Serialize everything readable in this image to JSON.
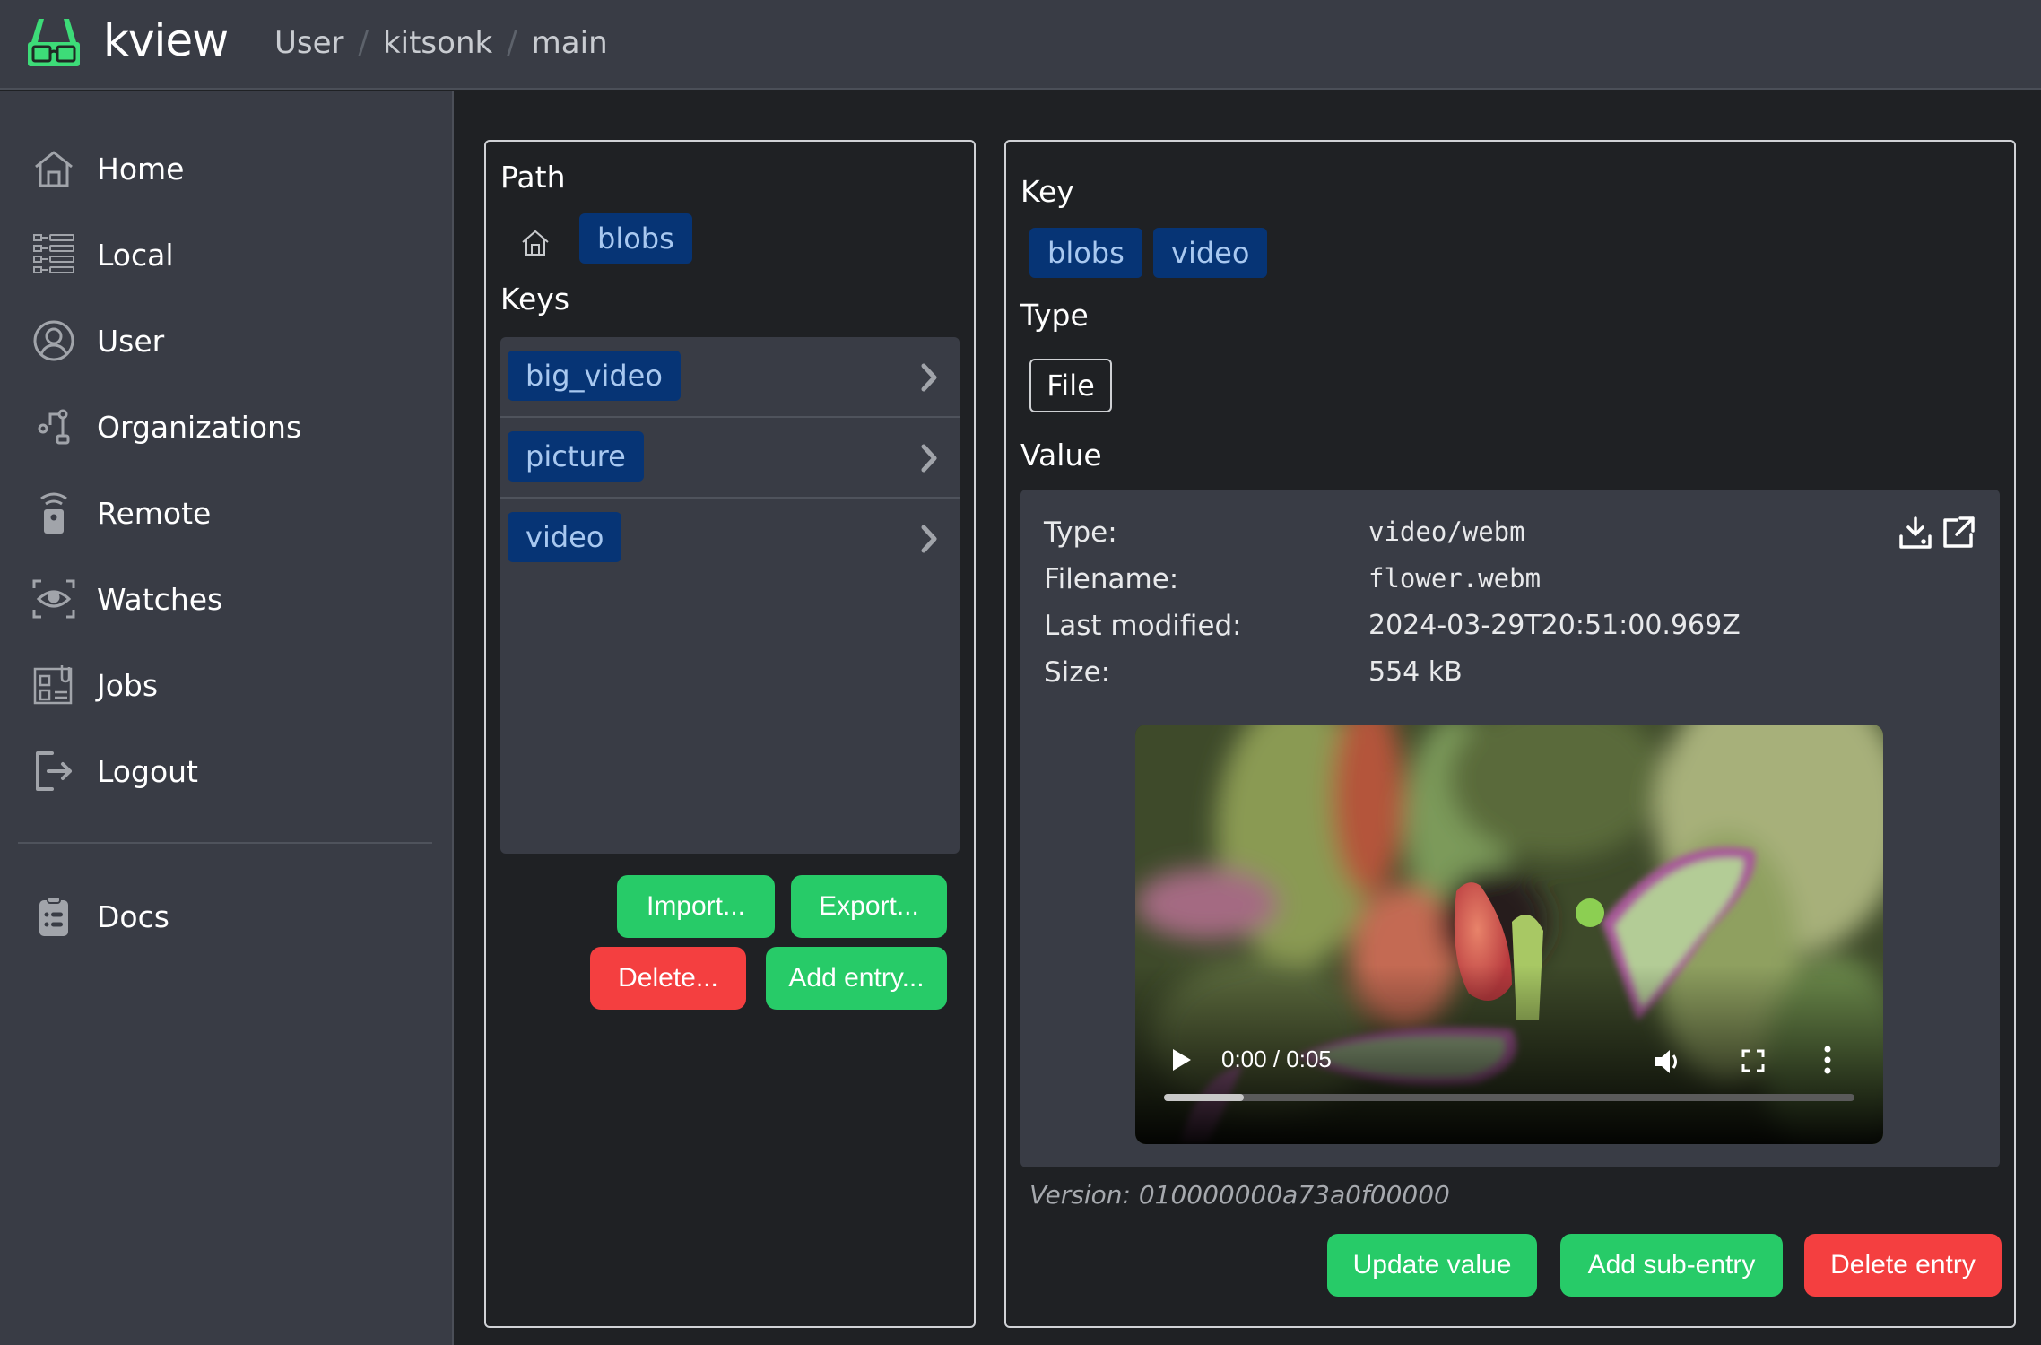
{
  "header": {
    "brand": "kview",
    "breadcrumb": [
      "User",
      "kitsonk",
      "main"
    ],
    "separator": "/",
    "brand_color": "#3ddc78"
  },
  "sidebar": {
    "items": [
      {
        "label": "Home",
        "icon": "home-icon"
      },
      {
        "label": "Local",
        "icon": "local-database-icon"
      },
      {
        "label": "User",
        "icon": "user-icon"
      },
      {
        "label": "Organizations",
        "icon": "organizations-icon"
      },
      {
        "label": "Remote",
        "icon": "remote-icon"
      },
      {
        "label": "Watches",
        "icon": "watches-icon"
      },
      {
        "label": "Jobs",
        "icon": "jobs-icon"
      },
      {
        "label": "Logout",
        "icon": "logout-icon"
      }
    ],
    "footer_items": [
      {
        "label": "Docs",
        "icon": "docs-icon"
      }
    ]
  },
  "left_panel": {
    "path_title": "Path",
    "path": [
      "blobs"
    ],
    "keys_title": "Keys",
    "keys": [
      "big_video",
      "picture",
      "video"
    ],
    "buttons": {
      "import": "Import...",
      "export": "Export...",
      "delete": "Delete...",
      "add_entry": "Add entry..."
    }
  },
  "right_panel": {
    "key_title": "Key",
    "key": [
      "blobs",
      "video"
    ],
    "type_title": "Type",
    "type": "File",
    "value_title": "Value",
    "file": {
      "type_label": "Type:",
      "type_value": "video/webm",
      "filename_label": "Filename:",
      "filename_value": "flower.webm",
      "modified_label": "Last modified:",
      "modified_value": "2024-03-29T20:51:00.969Z",
      "size_label": "Size:",
      "size_value": "554 kB"
    },
    "video": {
      "time": "0:00 / 0:05",
      "progress_buffered": 0.115
    },
    "version": "Version: 010000000a73a0f00000",
    "buttons": {
      "update": "Update value",
      "add_sub": "Add sub-entry",
      "delete": "Delete entry"
    }
  },
  "colors": {
    "accent_green": "#27cb68",
    "danger_red": "#f43f40",
    "tag_bg": "#063475",
    "tag_text": "#a8c8f0"
  }
}
